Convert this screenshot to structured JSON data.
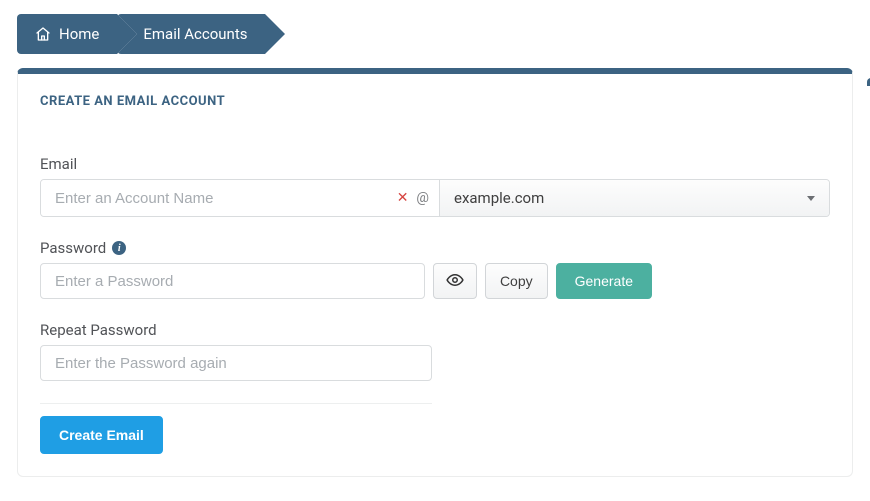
{
  "breadcrumb": {
    "home": "Home",
    "current": "Email Accounts"
  },
  "panel": {
    "title": "CREATE AN EMAIL ACCOUNT"
  },
  "email": {
    "label": "Email",
    "placeholder": "Enter an Account Name",
    "clear_glyph": "✕",
    "at_glyph": "@",
    "domain": "example.com"
  },
  "password": {
    "label": "Password",
    "placeholder": "Enter a Password",
    "copy_label": "Copy",
    "generate_label": "Generate"
  },
  "repeat": {
    "label": "Repeat Password",
    "placeholder": "Enter the Password again"
  },
  "actions": {
    "create_label": "Create Email"
  }
}
